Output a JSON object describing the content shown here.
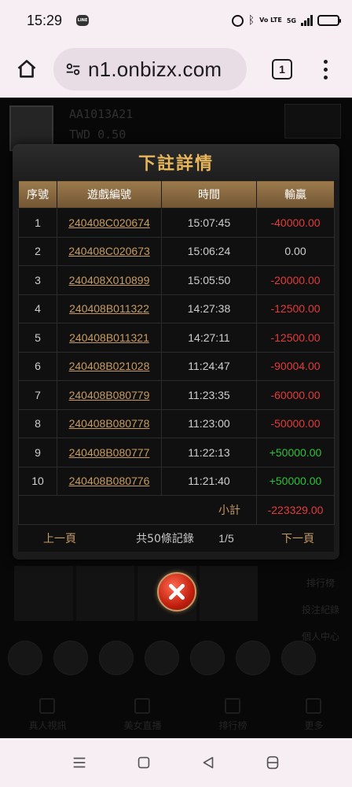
{
  "status_bar": {
    "time": "15:29",
    "app_icon": "LINE",
    "icons": [
      "alarm-icon",
      "bluetooth-icon",
      "volte-icon",
      "5g-signal-icon",
      "battery-icon"
    ],
    "network": "5G",
    "volte_label": "Vo LTE"
  },
  "browser": {
    "url": "n1.onbizx.com",
    "tab_count": "1"
  },
  "background_page": {
    "user_id": "AA1013A21",
    "balance": "TWD 0.50",
    "nav_items": [
      "真人視訊",
      "美女直播",
      "排行榜",
      "更多"
    ],
    "side_items": [
      "排行榜",
      "投注紀錄",
      "個人中心"
    ]
  },
  "modal": {
    "title": "下註詳情",
    "columns": [
      "序號",
      "遊戲編號",
      "時間",
      "輸贏"
    ],
    "rows": [
      {
        "no": "1",
        "game_id": "240408C020674",
        "time": "15:07:45",
        "result": "-40000.00",
        "sign": "neg"
      },
      {
        "no": "2",
        "game_id": "240408C020673",
        "time": "15:06:24",
        "result": "0.00",
        "sign": "zero"
      },
      {
        "no": "3",
        "game_id": "240408X010899",
        "time": "15:05:50",
        "result": "-20000.00",
        "sign": "neg"
      },
      {
        "no": "4",
        "game_id": "240408B011322",
        "time": "14:27:38",
        "result": "-12500.00",
        "sign": "neg"
      },
      {
        "no": "5",
        "game_id": "240408B011321",
        "time": "14:27:11",
        "result": "-12500.00",
        "sign": "neg"
      },
      {
        "no": "6",
        "game_id": "240408B021028",
        "time": "11:24:47",
        "result": "-90004.00",
        "sign": "neg"
      },
      {
        "no": "7",
        "game_id": "240408B080779",
        "time": "11:23:35",
        "result": "-60000.00",
        "sign": "neg"
      },
      {
        "no": "8",
        "game_id": "240408B080778",
        "time": "11:23:00",
        "result": "-50000.00",
        "sign": "neg"
      },
      {
        "no": "9",
        "game_id": "240408B080777",
        "time": "11:22:13",
        "result": "+50000.00",
        "sign": "pos"
      },
      {
        "no": "10",
        "game_id": "240408B080776",
        "time": "11:21:40",
        "result": "+50000.00",
        "sign": "pos"
      }
    ],
    "subtotal_label": "小計",
    "subtotal_value": "-223329.00",
    "pager": {
      "prev": "上一頁",
      "total": "共50條記錄",
      "page": "1/5",
      "next": "下一頁"
    }
  },
  "colors": {
    "accent_gold": "#c79b63",
    "title_gold": "#e8b65a",
    "loss_red": "#e33b3b",
    "win_green": "#2ec13a"
  }
}
